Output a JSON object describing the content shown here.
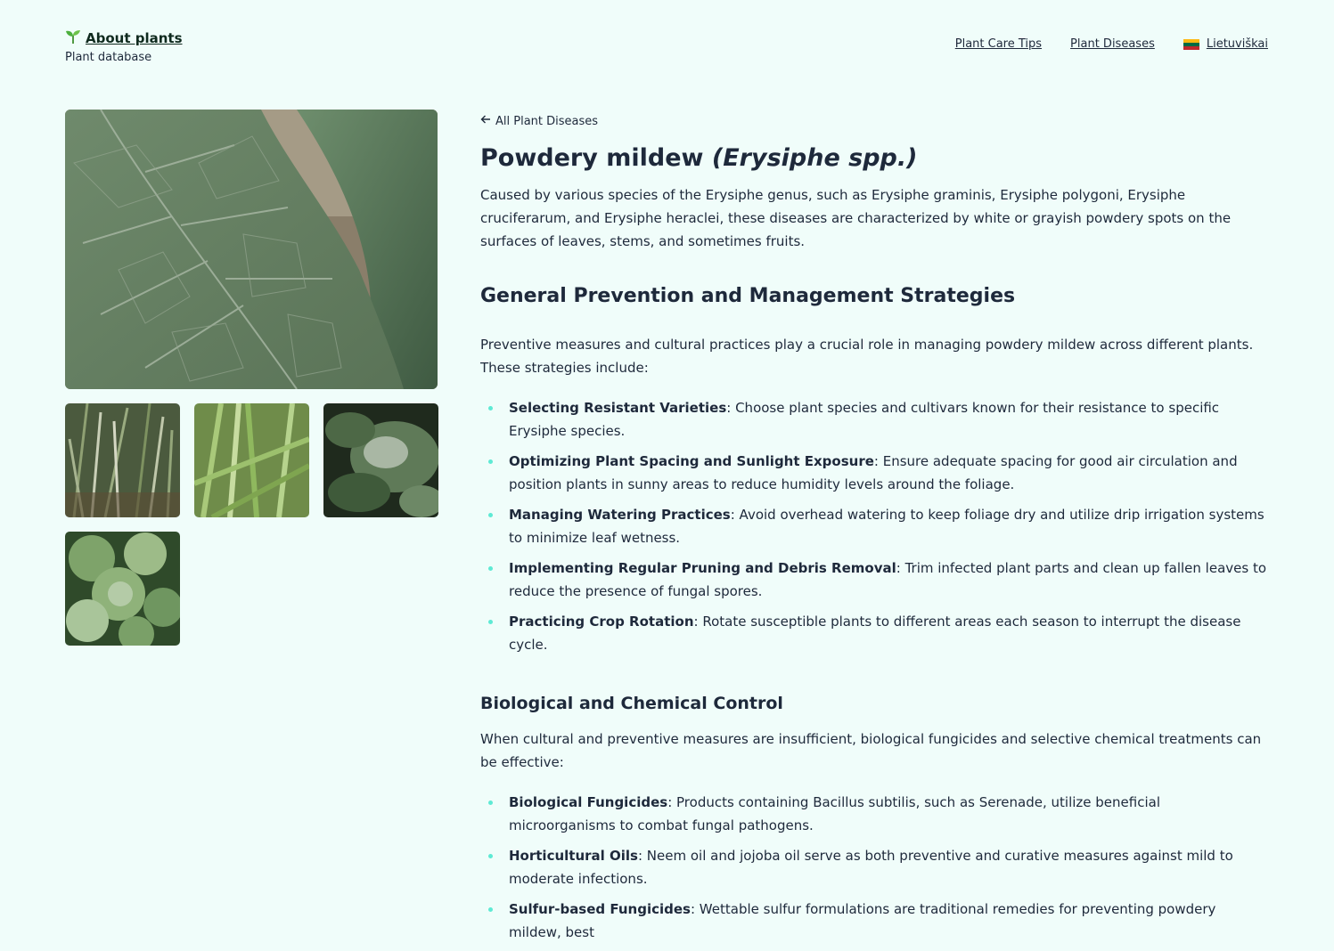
{
  "brand": {
    "title": "About plants",
    "subtitle": "Plant database",
    "icon": "sprout-icon"
  },
  "nav": {
    "links": [
      "Plant Care Tips",
      "Plant Diseases"
    ],
    "language": "Lietuviškai",
    "flag_colors": [
      "#fdb913",
      "#006a44",
      "#c1272d"
    ]
  },
  "back_link": "All Plant Diseases",
  "title": {
    "common": "Powdery mildew",
    "latin": "(Erysiphe spp.)"
  },
  "lead": "Caused by various species of the Erysiphe genus, such as Erysiphe graminis, Erysiphe polygoni, Erysiphe cruciferarum, and Erysiphe heraclei, these diseases are characterized by white or grayish powdery spots on the surfaces of leaves, stems, and sometimes fruits.",
  "section1": {
    "heading": "General Prevention and Management Strategies",
    "intro": "Preventive measures and cultural practices play a crucial role in managing powdery mildew across different plants. These strategies include:",
    "items": [
      {
        "term": "Selecting Resistant Varieties",
        "text": ": Choose plant species and cultivars known for their resistance to specific Erysiphe species."
      },
      {
        "term": "Optimizing Plant Spacing and Sunlight Exposure",
        "text": ": Ensure adequate spacing for good air circulation and position plants in sunny areas to reduce humidity levels around the foliage."
      },
      {
        "term": "Managing Watering Practices",
        "text": ": Avoid overhead watering to keep foliage dry and utilize drip irrigation systems to minimize leaf wetness."
      },
      {
        "term": "Implementing Regular Pruning and Debris Removal",
        "text": ": Trim infected plant parts and clean up fallen leaves to reduce the presence of fungal spores."
      },
      {
        "term": "Practicing Crop Rotation",
        "text": ": Rotate susceptible plants to different areas each season to interrupt the disease cycle."
      }
    ]
  },
  "section2": {
    "heading": "Biological and Chemical Control",
    "intro": "When cultural and preventive measures are insufficient, biological fungicides and selective chemical treatments can be effective:",
    "items": [
      {
        "term": "Biological Fungicides",
        "text": ": Products containing Bacillus subtilis, such as Serenade, utilize beneficial microorganisms to combat fungal pathogens."
      },
      {
        "term": "Horticultural Oils",
        "text": ": Neem oil and jojoba oil serve as both preventive and curative measures against mild to moderate infections."
      },
      {
        "term": "Sulfur-based Fungicides",
        "text": ": Wettable sulfur formulations are traditional remedies for preventing powdery mildew, best"
      }
    ]
  },
  "colors": {
    "background": "#f0fdfa",
    "bullet": "#5eead4",
    "text": "#1e293b"
  }
}
